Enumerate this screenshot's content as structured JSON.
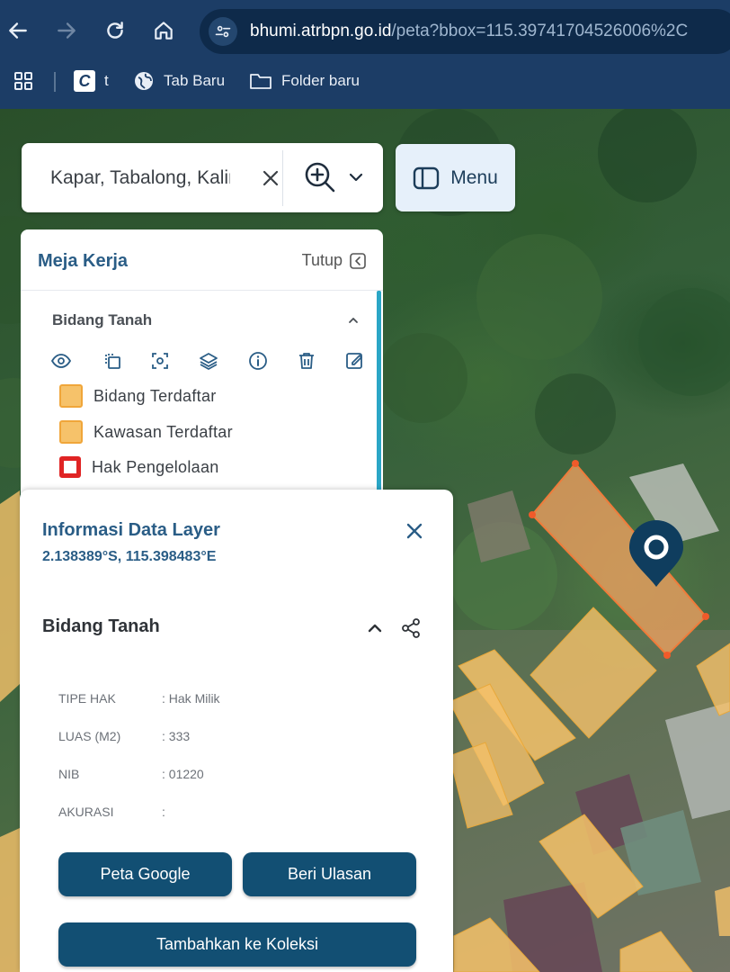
{
  "browser": {
    "url_host": "bhumi.atrbpn.go.id",
    "url_path": "/peta?bbox=115.39741704526006%2C",
    "nav_icons": [
      "back-icon",
      "forward-icon",
      "reload-icon",
      "home-icon"
    ],
    "bookmarks": [
      {
        "label": "t",
        "icon": "bookmark-c-icon"
      },
      {
        "label": "Tab Baru",
        "icon": "globe-icon"
      },
      {
        "label": "Folder baru",
        "icon": "folder-icon"
      }
    ]
  },
  "search": {
    "value": "Kapar, Tabalong, Kalimantan Selatan",
    "zoom_icon": "zoom-in-icon"
  },
  "menu": {
    "label": "Menu"
  },
  "workspace": {
    "title": "Meja Kerja",
    "close_label": "Tutup",
    "section_title": "Bidang Tanah",
    "tool_icons": [
      "eye-icon",
      "copy-icon",
      "focus-icon",
      "layers-icon",
      "info-icon",
      "trash-icon",
      "edit-icon"
    ],
    "legend": [
      {
        "label": "Bidang Terdaftar",
        "color": "#f6c26a",
        "style": "fill"
      },
      {
        "label": "Kawasan Terdaftar",
        "color": "#f6c26a",
        "style": "fill"
      },
      {
        "label": "Hak Pengelolaan",
        "color": "#e02424",
        "style": "outline"
      }
    ]
  },
  "info_panel": {
    "title": "Informasi Data Layer",
    "coordinates": "2.138389°S, 115.398483°E",
    "section_title": "Bidang Tanah",
    "attributes": [
      {
        "key": "TIPE HAK",
        "value": ": Hak Milik"
      },
      {
        "key": "LUAS (M2)",
        "value": ": 333"
      },
      {
        "key": "NIB",
        "value": ": 01220"
      },
      {
        "key": "AKURASI",
        "value": ":"
      }
    ],
    "buttons": {
      "google": "Peta Google",
      "review": "Beri Ulasan",
      "collection": "Tambahkan ke Koleksi"
    }
  },
  "colors": {
    "chrome": "#1c3d66",
    "accent": "#124f73",
    "parcel_selected": "#f0a060",
    "parcel": "#f6c26a",
    "pin": "#0f3d5e"
  }
}
